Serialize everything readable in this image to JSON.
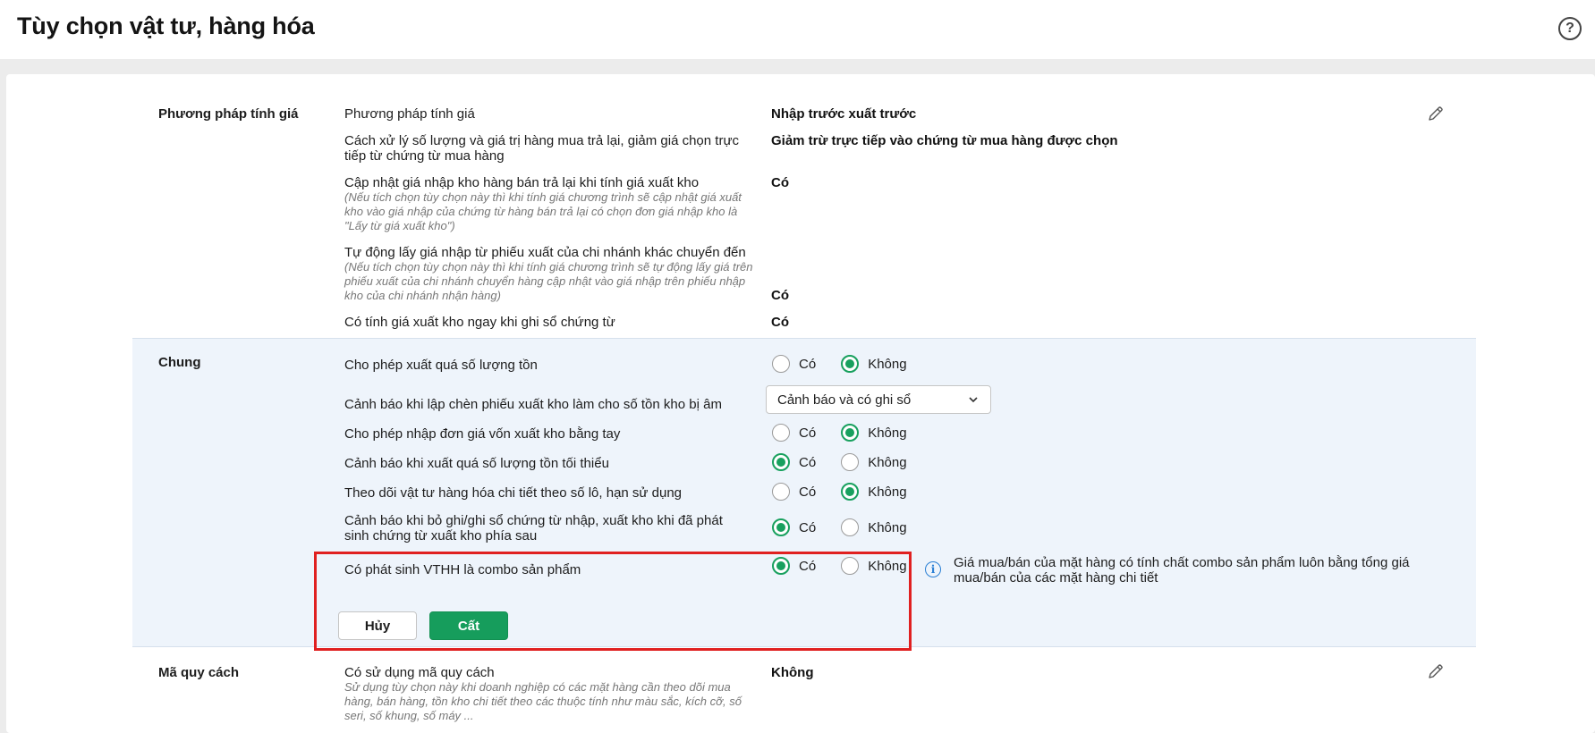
{
  "page": {
    "title": "Tùy chọn vật tư, hàng hóa",
    "help_icon": "?"
  },
  "pricing": {
    "section_title": "Phương pháp tính giá",
    "rows": [
      {
        "label": "Phương pháp tính giá",
        "value": "Nhập trước xuất trước"
      },
      {
        "label": "Cách xử lý số lượng và giá trị hàng mua trả lại, giảm giá chọn trực tiếp từ chứng từ mua hàng",
        "value": "Giảm trừ trực tiếp vào chứng từ mua hàng được chọn"
      },
      {
        "label": "Cập nhật giá nhập kho hàng bán trả lại khi tính giá xuất kho",
        "note": "(Nếu tích chọn tùy chọn này thì khi tính giá chương trình sẽ cập nhật giá xuất kho vào giá nhập của chứng từ hàng bán trả lại có chọn đơn giá nhập kho là \"Lấy từ giá xuất kho\")",
        "value": "Có"
      },
      {
        "label": "Tự động lấy giá nhập từ phiếu xuất của chi nhánh khác chuyển đến",
        "note": "(Nếu tích chọn tùy chọn này thì khi tính giá chương trình sẽ tự động lấy giá trên phiếu xuất của chi nhánh chuyển hàng cập nhật vào giá nhập trên phiếu nhập kho của chi nhánh nhận hàng)",
        "value": "Có"
      },
      {
        "label": "Có tính giá xuất kho ngay khi ghi sổ chứng từ",
        "value": "Có"
      }
    ]
  },
  "general": {
    "section_title": "Chung",
    "yes": "Có",
    "no": "Không",
    "rows": [
      {
        "label": "Cho phép xuất quá số lượng tồn",
        "selected": "Không"
      },
      {
        "label": "Cảnh báo khi lập chèn phiếu xuất kho làm cho số tồn kho bị âm",
        "select_value": "Cảnh báo và có ghi sổ"
      },
      {
        "label": "Cho phép nhập đơn giá vốn xuất kho bằng tay",
        "selected": "Không"
      },
      {
        "label": "Cảnh báo khi xuất quá số lượng tồn tối thiểu",
        "selected": "Có"
      },
      {
        "label": "Theo dõi vật tư hàng hóa chi tiết theo số lô, hạn sử dụng",
        "selected": "Không"
      },
      {
        "label": "Cảnh báo khi bỏ ghi/ghi sổ chứng từ nhập, xuất kho khi đã phát sinh chứng từ xuất kho phía sau",
        "selected": "Có"
      },
      {
        "label": "Có phát sinh VTHH là combo sản phẩm",
        "selected": "Có"
      }
    ],
    "info_text": "Giá mua/bán của mặt hàng có tính chất combo sản phẩm luôn bằng tổng giá mua/bán của các mặt hàng chi tiết",
    "cancel_label": "Hủy",
    "save_label": "Cất"
  },
  "spec": {
    "section_title": "Mã quy cách",
    "label": "Có sử dụng mã quy cách",
    "note": "Sử dụng tùy chọn này khi doanh nghiệp có các mặt hàng cần theo dõi mua hàng, bán hàng, tồn kho chi tiết theo các thuộc tính như màu sắc, kích cỡ, số seri, số khung, số máy ...",
    "value": "Không"
  },
  "colors": {
    "accent_green": "#169d5c",
    "highlight_red": "#e02020",
    "info_blue": "#2a7fd4",
    "section_bg": "#eef4fb"
  },
  "icons": {
    "edit": "pencil-icon",
    "help": "question-circle-icon",
    "info": "info-circle-icon",
    "dropdown": "chevron-down-icon"
  }
}
